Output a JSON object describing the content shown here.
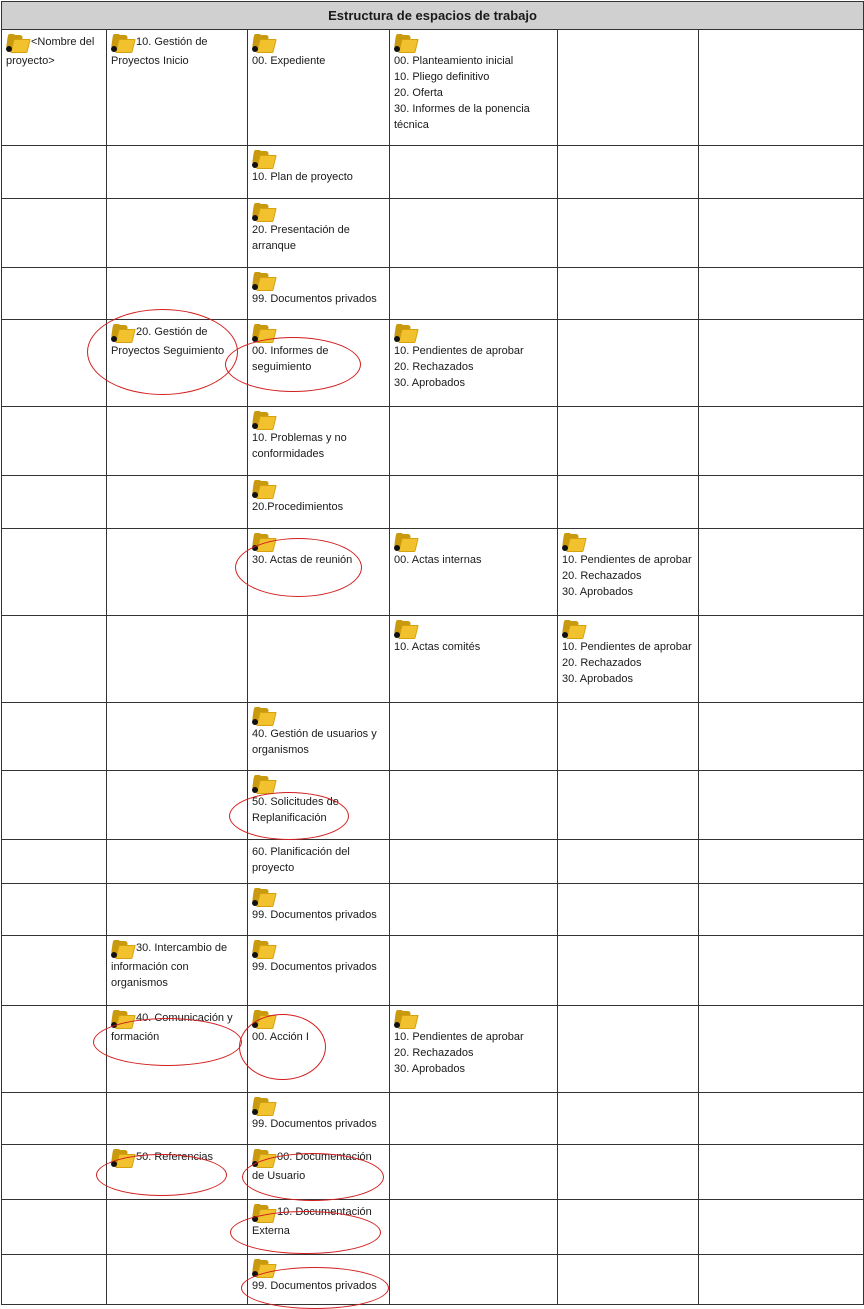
{
  "title": "Estructura de espacios de trabajo",
  "icon_names": [
    "folder-icon"
  ],
  "rows": [
    {
      "c1": "<Nombre del proyecto>",
      "c2": "10. Gestión de Proyectos Inicio",
      "c3": "00. Expediente",
      "c4": [
        "00. Planteamiento inicial",
        "10. Pliego definitivo",
        "20. Oferta",
        "30. Informes de la ponencia técnica"
      ]
    },
    {
      "c3": "10. Plan de proyecto"
    },
    {
      "c3": "20. Presentación de arranque"
    },
    {
      "c3": "99. Documentos privados"
    },
    {
      "c2": "20. Gestión de Proyectos Seguimiento",
      "c3": "00. Informes de seguimiento",
      "c4": [
        "10. Pendientes de aprobar",
        "20. Rechazados",
        "30. Aprobados"
      ]
    },
    {
      "c3": "10. Problemas y no conformidades"
    },
    {
      "c3": "20.Procedimientos"
    },
    {
      "c3": "30. Actas de reunión",
      "c4": "00. Actas internas",
      "c5": [
        "10. Pendientes de aprobar",
        "20. Rechazados",
        "30. Aprobados"
      ]
    },
    {
      "c4": "10. Actas comités",
      "c5": [
        "10. Pendientes de aprobar",
        "20. Rechazados",
        "30. Aprobados"
      ]
    },
    {
      "c3": "40. Gestión de usuarios y organismos"
    },
    {
      "c3": "50. Solicitudes de Replanificación"
    },
    {
      "c3": "60. Planificación del proyecto"
    },
    {
      "c3": "99. Documentos privados"
    },
    {
      "c2": "30. Intercambio de información con organismos",
      "c3": "99. Documentos privados"
    },
    {
      "c2": "40. Comunicación y formación",
      "c3": "00. Acción I",
      "c4": [
        "10. Pendientes de aprobar",
        "20. Rechazados",
        "30. Aprobados"
      ]
    },
    {
      "c3": "99. Documentos privados"
    },
    {
      "c2": "50. Referencias",
      "c3": "00. Documentación de Usuario"
    },
    {
      "c3": "10. Documentación Externa"
    },
    {
      "c3": "99. Documentos privados"
    }
  ],
  "annotation_color": "#d21e1e"
}
